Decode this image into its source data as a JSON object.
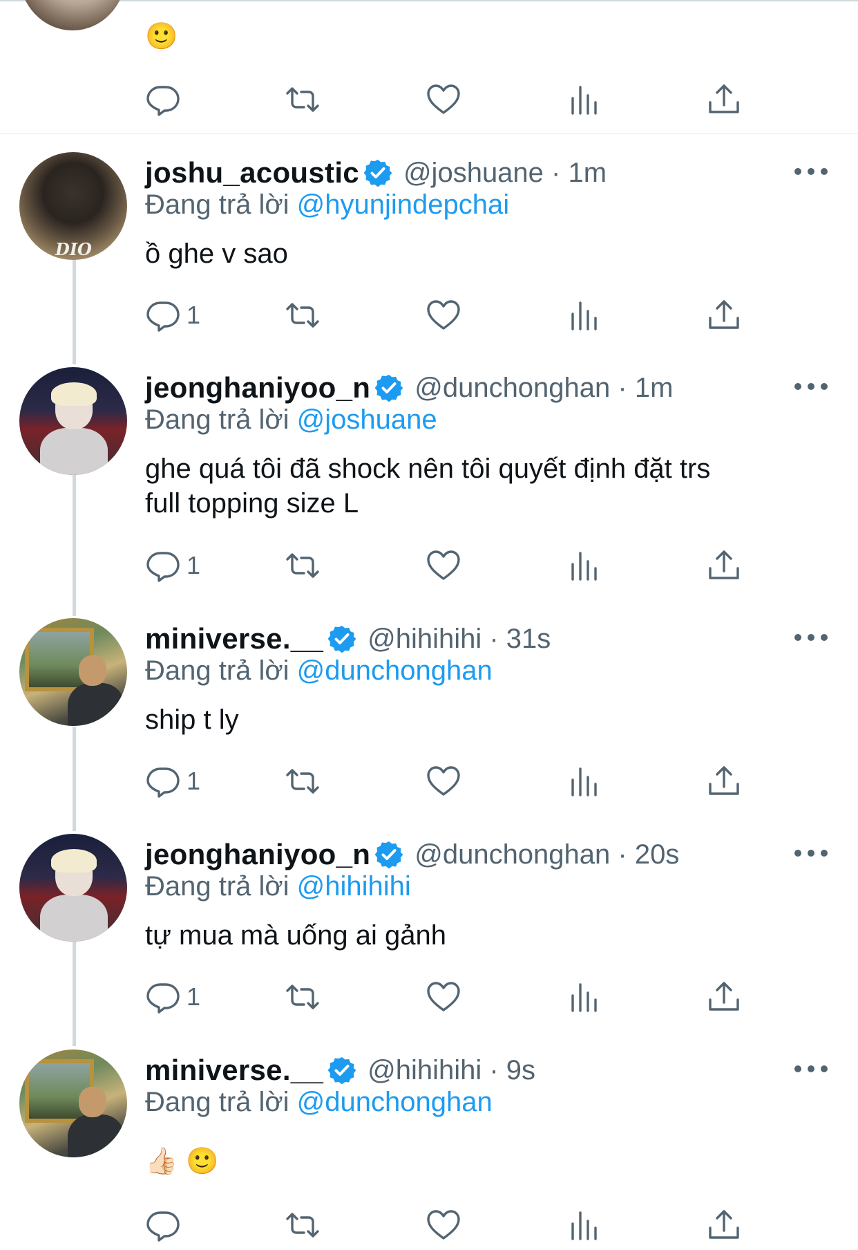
{
  "previous_tweet": {
    "text": "🙂",
    "actions": {
      "reply_count": "",
      "retweet_count": "",
      "like_count": "",
      "view_count": ""
    }
  },
  "colors": {
    "link": "#1d9bf0",
    "secondary_text": "#536471",
    "verified_badge": "#1d9bf0",
    "thread_line": "#cfd9de"
  },
  "icons": {
    "reply": "reply-icon",
    "retweet": "retweet-icon",
    "like": "heart-icon",
    "views": "views-icon",
    "share": "share-icon",
    "more": "more-icon",
    "verified": "verified-badge-icon"
  },
  "reply_prefix": "Đang trả lời",
  "tweets": [
    {
      "display_name": "joshu_acoustic",
      "handle_time": "@joshuane · 1m",
      "reply_to": "@hyunjindepchai",
      "text": "ồ ghe v sao",
      "reply_count": "1",
      "avatar_logo": "DIO"
    },
    {
      "display_name": "jeonghaniyoo_n",
      "handle_time": "@dunchonghan · 1m",
      "reply_to": "@joshuane",
      "text_line1": "ghe quá tôi đã shock nên tôi quyết định đặt trs",
      "text_line2": "full topping size L",
      "reply_count": "1"
    },
    {
      "display_name": "miniverse.__",
      "handle_time": "@hihihihi · 31s",
      "reply_to": "@dunchonghan",
      "text": "ship t ly",
      "reply_count": "1"
    },
    {
      "display_name": "jeonghaniyoo_n",
      "handle_time": "@dunchonghan · 20s",
      "reply_to": "@hihihihi",
      "text": "tự mua mà uống ai gảnh",
      "reply_count": "1"
    },
    {
      "display_name": "miniverse.__",
      "handle_time": "@hihihihi · 9s",
      "reply_to": "@dunchonghan",
      "text": "👍🏻 🙂",
      "reply_count": ""
    }
  ]
}
